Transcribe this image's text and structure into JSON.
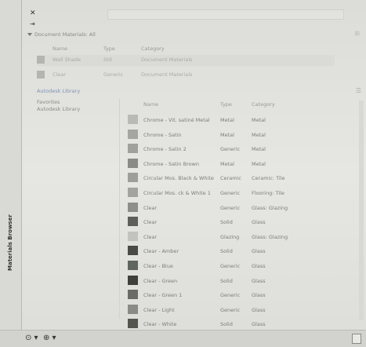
{
  "window": {
    "close_glyph": "✕",
    "pin_glyph": "⇥",
    "vertical_title": "Materials Browser"
  },
  "document_section": {
    "title": "Document Materials: All",
    "columns": {
      "name": "Name",
      "type": "Type",
      "category": "Category"
    },
    "rows": [
      {
        "name": "Wall Shade",
        "type": "Std",
        "category": "Document Materials",
        "swatch": "#9d9d98"
      },
      {
        "name": "Clear",
        "type": "Generic",
        "category": "Document Materials",
        "swatch": "#b0b0ab"
      }
    ]
  },
  "library": {
    "header": "Autodesk Library",
    "tree": [
      "Favorites",
      "Autodesk Library"
    ],
    "columns": {
      "name": "Name",
      "type": "Type",
      "category": "Category"
    },
    "rows": [
      {
        "name": "Chrome - Vit. satiné Metal",
        "type": "Metal",
        "category": "Metal",
        "swatch": "#b9b9b6"
      },
      {
        "name": "Chrome - Satin",
        "type": "Metal",
        "category": "Metal",
        "swatch": "#a5a5a1"
      },
      {
        "name": "Chrome - Satin 2",
        "type": "Generic",
        "category": "Metal",
        "swatch": "#a0a09c"
      },
      {
        "name": "Chrome - Satin Brown",
        "type": "Metal",
        "category": "Metal",
        "swatch": "#8a8a86"
      },
      {
        "name": "Circular Mos. Black & White",
        "type": "Ceramic",
        "category": "Ceramic: Tile",
        "swatch": "#9e9e9a"
      },
      {
        "name": "Circular Mos. ck & White 1",
        "type": "Generic",
        "category": "Flooring: Tile",
        "swatch": "#a3a39f"
      },
      {
        "name": "Clear",
        "type": "Generic",
        "category": "Glass: Glazing",
        "swatch": "#8e8e8a"
      },
      {
        "name": "Clear",
        "type": "Solid",
        "category": "Glass",
        "swatch": "#5e5e5a"
      },
      {
        "name": "Clear",
        "type": "Glazing",
        "category": "Glass: Glazing",
        "swatch": "#c2c2bf"
      },
      {
        "name": "Clear - Amber",
        "type": "Solid",
        "category": "Glass",
        "swatch": "#4a4a46"
      },
      {
        "name": "Clear - Blue",
        "type": "Generic",
        "category": "Glass",
        "swatch": "#606560"
      },
      {
        "name": "Clear - Green",
        "type": "Solid",
        "category": "Glass",
        "swatch": "#3f403d"
      },
      {
        "name": "Clear - Green 1",
        "type": "Generic",
        "category": "Glass",
        "swatch": "#6a6a66"
      },
      {
        "name": "Clear - Light",
        "type": "Generic",
        "category": "Glass",
        "swatch": "#8a8a86"
      },
      {
        "name": "Clear - White",
        "type": "Solid",
        "category": "Glass",
        "swatch": "#55554f"
      }
    ]
  },
  "toolbar_icons": [
    "home-icon",
    "materials-icon"
  ]
}
